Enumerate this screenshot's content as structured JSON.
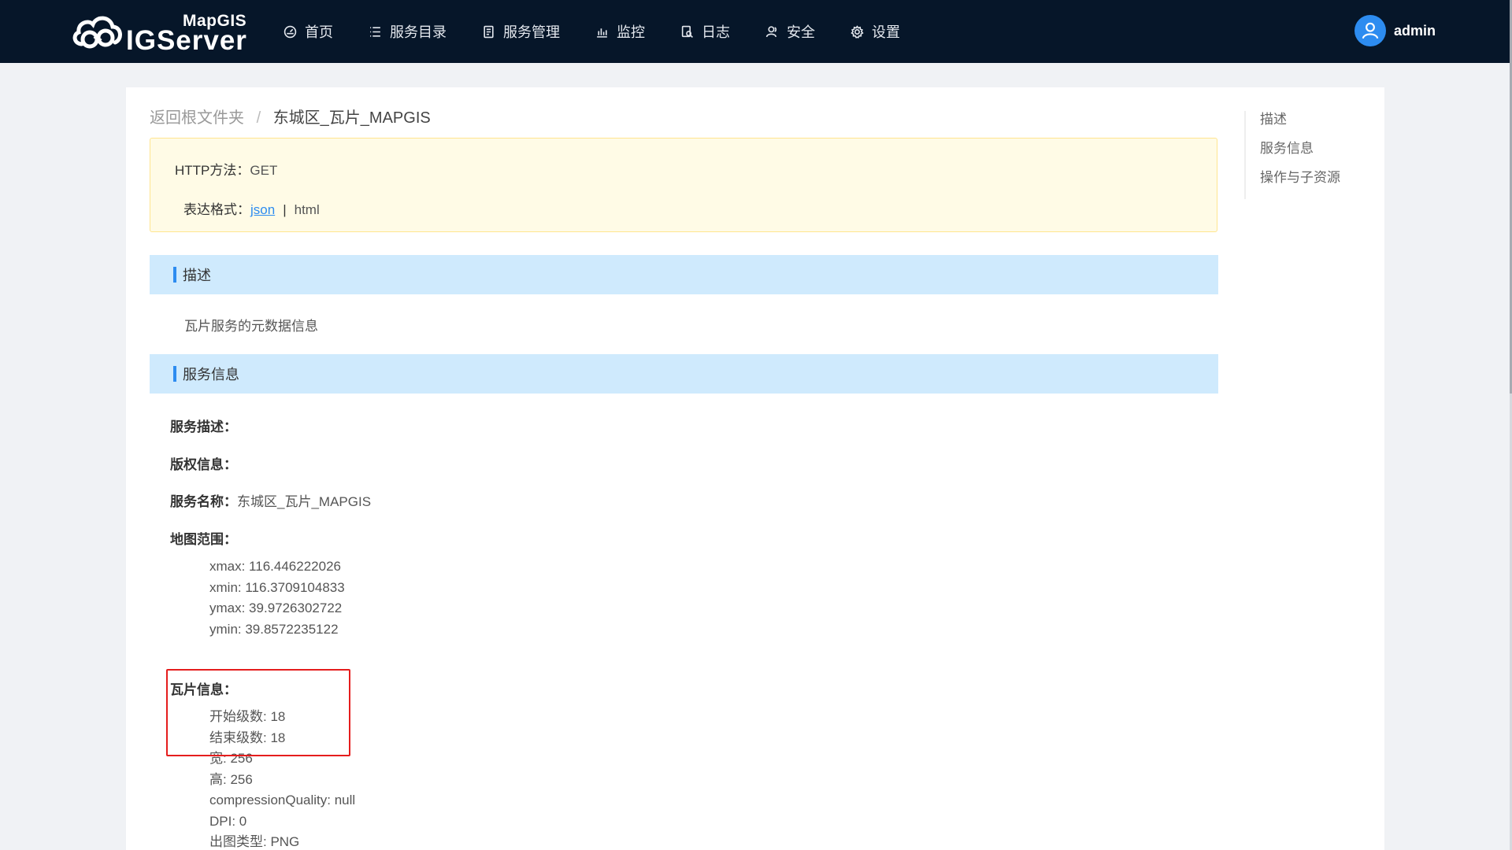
{
  "brand": {
    "top": "MapGIS",
    "main": "IGServer"
  },
  "nav": [
    {
      "icon": "dashboard-icon",
      "label": "首页"
    },
    {
      "icon": "list-icon",
      "label": "服务目录"
    },
    {
      "icon": "document-icon",
      "label": "服务管理"
    },
    {
      "icon": "bar-chart-icon",
      "label": "监控"
    },
    {
      "icon": "log-search-icon",
      "label": "日志"
    },
    {
      "icon": "users-icon",
      "label": "安全"
    },
    {
      "icon": "gear-icon",
      "label": "设置"
    }
  ],
  "user": {
    "name": "admin"
  },
  "breadcrumb": {
    "root": "返回根文件夹",
    "separator": "/",
    "current": "东城区_瓦片_MAPGIS"
  },
  "method": {
    "http_label": "HTTP方法：",
    "http_value": "GET",
    "format_label": "表达格式：",
    "format_json": "json",
    "format_sep": "|",
    "format_html": "html"
  },
  "sections": {
    "describe": {
      "title": "描述",
      "text": "瓦片服务的元数据信息"
    },
    "service_info": {
      "title": "服务信息"
    }
  },
  "service": {
    "desc_label": "服务描述：",
    "copyright_label": "版权信息：",
    "name_label": "服务名称：",
    "name_value": "东城区_瓦片_MAPGIS",
    "extent_label": "地图范围：",
    "extent": [
      "xmax: 116.446222026",
      "xmin: 116.3709104833",
      "ymax: 39.9726302722",
      "ymin: 39.8572235122"
    ],
    "tile_label": "瓦片信息：",
    "tile": [
      "开始级数: 18",
      "结束级数: 18",
      "宽: 256",
      "高: 256",
      "compressionQuality: null",
      "DPI: 0",
      "出图类型: PNG"
    ]
  },
  "anchors": [
    "描述",
    "服务信息",
    "操作与子资源"
  ],
  "colors": {
    "header_bg": "#061629",
    "accent": "#2d8cf0",
    "section_bg": "#cfeafd",
    "highlight": "#e51d1d"
  }
}
